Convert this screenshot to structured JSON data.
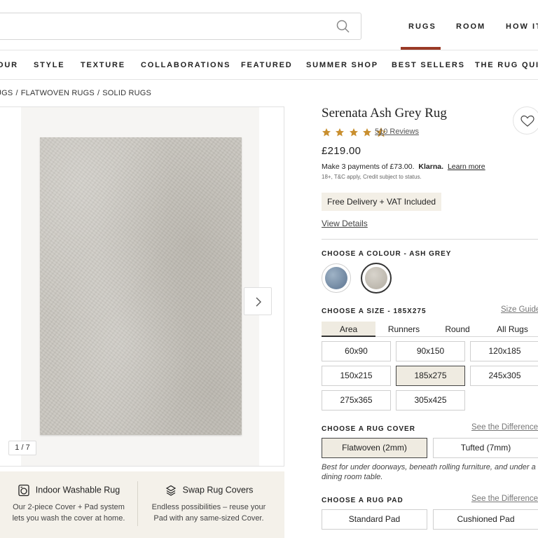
{
  "header": {
    "search_placeholder": "",
    "nav": [
      "RUGS",
      "ROOM",
      "HOW IT"
    ]
  },
  "category_nav": [
    "OUR",
    "STYLE",
    "TEXTURE",
    "COLLABORATIONS",
    "FEATURED",
    "SUMMER SHOP",
    "BEST SELLERS",
    "THE RUG QUIZ"
  ],
  "breadcrumb": [
    "UGS",
    "FLATWOVEN RUGS",
    "SOLID RUGS"
  ],
  "breadcrumb_sep": "/",
  "gallery": {
    "counter": "1 / 7"
  },
  "features": [
    {
      "icon": "washing-machine-icon",
      "title": "Indoor Washable Rug",
      "desc": "Our 2-piece Cover + Pad system lets you wash the cover at home."
    },
    {
      "icon": "swap-icon",
      "title": "Swap Rug Covers",
      "desc": "Endless possibilities – reuse your Pad with any same-sized Cover."
    }
  ],
  "product": {
    "title": "Serenata Ash Grey Rug",
    "rating": 4.5,
    "reviews": "510 Reviews",
    "price": "£219.00",
    "klarna_prefix": "Make 3 payments of £73.00.",
    "klarna_brand": "Klarna.",
    "klarna_link": "Learn more",
    "klarna_terms": "18+, T&C apply, Credit subject to status.",
    "delivery": "Free Delivery + VAT Included",
    "view_details": "View Details"
  },
  "colour": {
    "label": "CHOOSE A COLOUR - ASH GREY",
    "swatches": [
      {
        "name": "blue",
        "color": "#7e95aa",
        "selected": false
      },
      {
        "name": "ash-grey",
        "color": "#c7c3bb",
        "selected": true
      }
    ]
  },
  "size": {
    "label": "CHOOSE A SIZE - 185X275",
    "guide": "Size Guide",
    "tabs": [
      "Area",
      "Runners",
      "Round",
      "All Rugs"
    ],
    "active_tab": "Area",
    "options": [
      "60x90",
      "90x150",
      "120x185",
      "150x215",
      "185x275",
      "245x305",
      "275x365",
      "305x425"
    ],
    "selected": "185x275"
  },
  "cover": {
    "label": "CHOOSE A RUG COVER",
    "link": "See the Difference",
    "options": [
      "Flatwoven (2mm)",
      "Tufted (7mm)"
    ],
    "selected": "Flatwoven (2mm)",
    "note": "Best for under doorways, beneath rolling furniture, and under a dining room table."
  },
  "pad": {
    "label": "CHOOSE A RUG PAD",
    "link": "See the Difference",
    "options": [
      "Standard Pad",
      "Cushioned Pad"
    ]
  },
  "colors": {
    "accent": "#9a3a26",
    "selected_bg": "#efebe1",
    "star": "#c98f2f"
  }
}
